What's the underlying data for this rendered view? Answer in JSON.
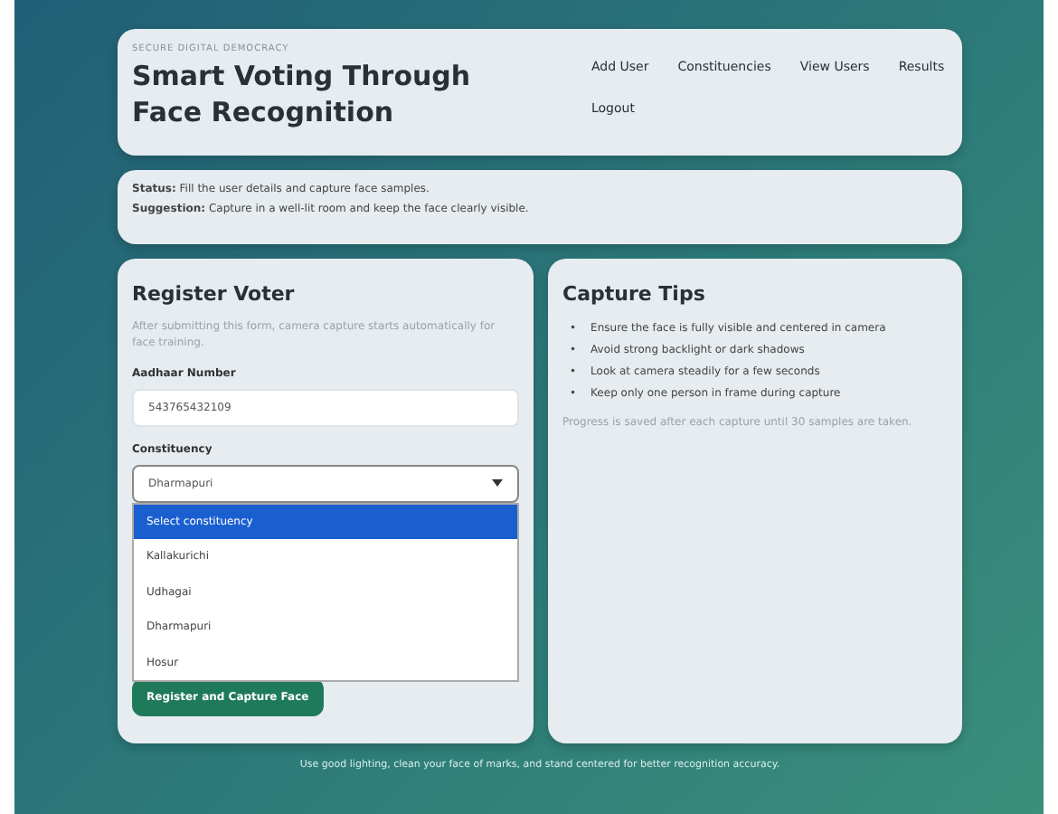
{
  "header": {
    "eyebrow": "SECURE DIGITAL DEMOCRACY",
    "title": "Smart Voting Through Face Recognition",
    "nav": [
      "Add User",
      "Constituencies",
      "View Users",
      "Results",
      "Logout"
    ]
  },
  "status": [
    {
      "label": "Status:",
      "text": "Fill the user details and capture face samples."
    },
    {
      "label": "Suggestion:",
      "text": "Capture in a well-lit room and keep the face clearly visible."
    }
  ],
  "register": {
    "title": "Register Voter",
    "subtitle": "After submitting this form, camera capture starts automatically for face training.",
    "fields": [
      {
        "label": "Aadhaar Number",
        "value": "543765432109"
      },
      {
        "label": "Constituency",
        "value": "Dharmapuri"
      }
    ],
    "options": [
      {
        "label": "Select constituency",
        "selected": true
      },
      {
        "label": "Kallakurichi",
        "selected": false
      },
      {
        "label": "Udhagai",
        "selected": false
      },
      {
        "label": "Dharmapuri",
        "selected": false
      },
      {
        "label": "Hosur",
        "selected": false
      }
    ],
    "button": "Register and Capture Face"
  },
  "tips": {
    "title": "Capture Tips",
    "items": [
      {
        "bullet": "•",
        "text": "Ensure the face is fully visible and centered in camera"
      },
      {
        "bullet": "•",
        "text": "Avoid strong backlight or dark shadows"
      },
      {
        "bullet": "•",
        "text": "Look at camera steadily for a few seconds"
      },
      {
        "bullet": "•",
        "text": "Keep only one person in frame during capture"
      }
    ],
    "note": "Progress is saved after each capture until 30 samples are taken."
  },
  "footer": "Use good lighting, clean your face of marks, and stand centered for better recognition accuracy."
}
